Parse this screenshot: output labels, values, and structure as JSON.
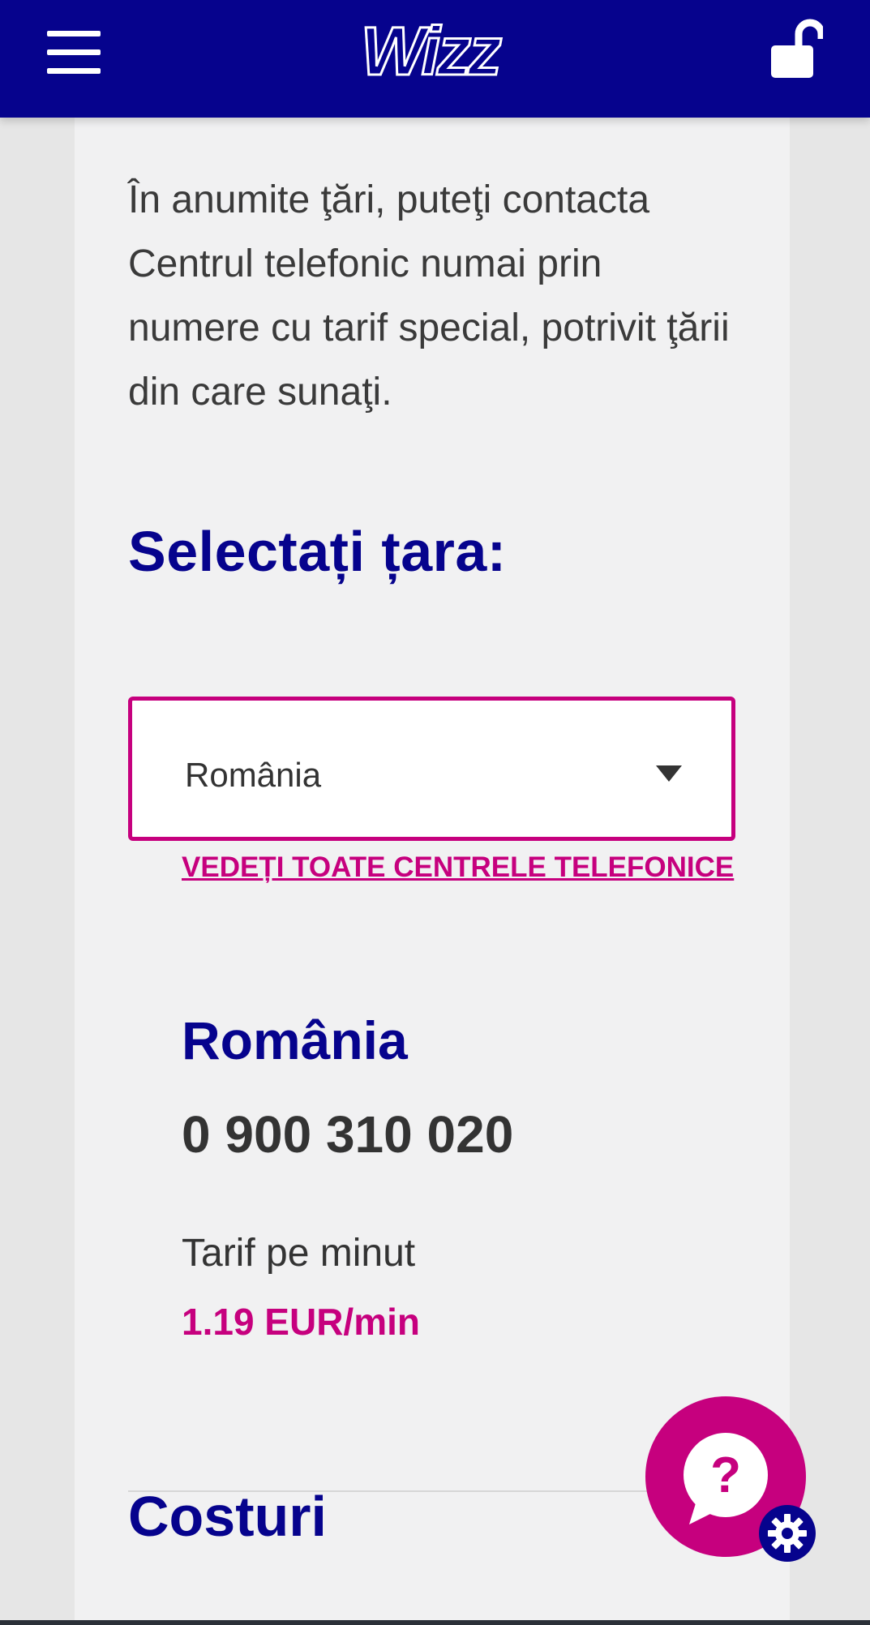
{
  "header": {
    "menu_icon": "hamburger-menu-icon",
    "logo_text": "Wizz",
    "lock_icon": "unlocked-padlock-icon",
    "brand_color": "#06038d"
  },
  "main": {
    "intro_text": "În anumite ţări, puteţi contacta Centrul telefonic numai prin numere cu tarif special, potrivit ţării din care sunaţi.",
    "select_heading": "Selectați țara:",
    "country_select": {
      "selected": "România",
      "icon": "caret-down-icon"
    },
    "all_centers_link": "VEDEȚI TOATE CENTRELE TELEFONICE",
    "contact": {
      "country": "România",
      "phone": "0 900 310 020",
      "rate_label": "Tarif pe minut",
      "rate_value": "1.19 EUR/min"
    },
    "costs_heading": "Costuri"
  },
  "floating": {
    "help_icon": "question-chat-bubble-icon",
    "settings_icon": "gear-icon"
  },
  "colors": {
    "accent": "#c6007e",
    "navy": "#06038d",
    "text": "#333333",
    "card_background": "#f1f1f2"
  }
}
